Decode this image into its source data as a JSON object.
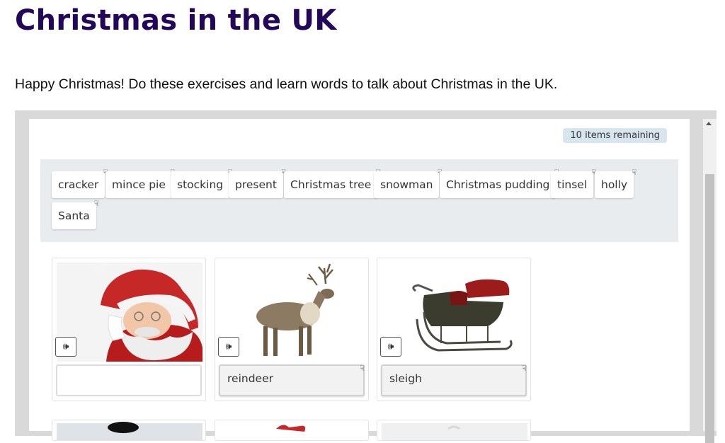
{
  "page": {
    "title": "Christmas in the UK",
    "intro": "Happy Christmas! Do these exercises and learn words to talk about Christmas in the UK."
  },
  "exercise": {
    "remaining": "10 items remaining",
    "drag_icon": "drag-handle-icon",
    "audio_icon": "speaker-icon",
    "word_bank": [
      {
        "label": "cracker"
      },
      {
        "label": "mince pie"
      },
      {
        "label": "stocking"
      },
      {
        "label": "present"
      },
      {
        "label": "Christmas tree"
      },
      {
        "label": "snowman"
      },
      {
        "label": "Christmas pudding"
      },
      {
        "label": "tinsel"
      },
      {
        "label": "holly"
      },
      {
        "label": "Santa"
      }
    ],
    "cards": [
      {
        "image": "santa-claus",
        "answer": ""
      },
      {
        "image": "reindeer",
        "answer": "reindeer"
      },
      {
        "image": "sleigh",
        "answer": "sleigh"
      }
    ],
    "next_row_images": [
      "snowman-partial",
      "red-item-partial",
      "snow-partial"
    ]
  },
  "colors": {
    "title": "#23085a",
    "frame": "#d9d9d9",
    "bank_bg": "#e8ecef",
    "badge_bg": "#d7e6ee"
  }
}
